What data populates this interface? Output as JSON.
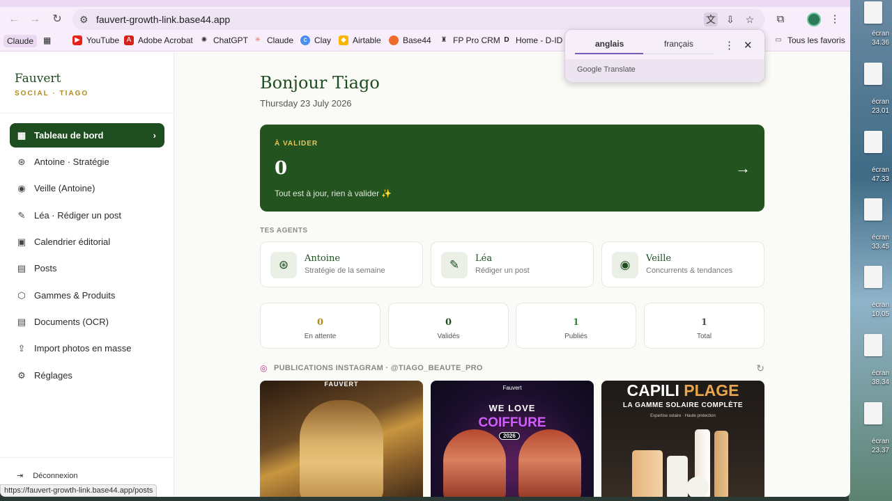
{
  "browser": {
    "url": "fauvert-growth-link.base44.app",
    "bookmarks": [
      "Claude",
      "YouTube",
      "Adobe Acrobat",
      "ChatGPT",
      "Claude",
      "Clay",
      "Airtable",
      "Base44",
      "FP Pro CRM",
      "Home - D-ID"
    ],
    "all_bookmarks": "Tous les favoris",
    "status_url": "https://fauvert-growth-link.base44.app/posts"
  },
  "translate_popup": {
    "lang_from": "anglais",
    "lang_to": "français",
    "brand": "Google Translate"
  },
  "sidebar": {
    "brand": "Fauvert",
    "subtitle": "SOCIAL · TIAGO",
    "items": [
      {
        "label": "Tableau de bord",
        "icon": "grid-icon"
      },
      {
        "label": "Antoine · Stratégie",
        "icon": "brain-icon"
      },
      {
        "label": "Veille (Antoine)",
        "icon": "eye-icon"
      },
      {
        "label": "Léa · Rédiger un post",
        "icon": "pen-icon"
      },
      {
        "label": "Calendrier éditorial",
        "icon": "calendar-icon"
      },
      {
        "label": "Posts",
        "icon": "document-icon"
      },
      {
        "label": "Gammes & Produits",
        "icon": "box-icon"
      },
      {
        "label": "Documents (OCR)",
        "icon": "file-icon"
      },
      {
        "label": "Import photos en masse",
        "icon": "upload-icon"
      },
      {
        "label": "Réglages",
        "icon": "gear-icon"
      }
    ],
    "logout": "Déconnexion"
  },
  "main": {
    "greeting": "Bonjour Tiago",
    "date": "Thursday 23 July 2026",
    "hero": {
      "label": "À VALIDER",
      "count": "0",
      "message": "Tout est à jour, rien à valider ✨"
    },
    "agents_title": "TES AGENTS",
    "agents": [
      {
        "name": "Antoine",
        "desc": "Stratégie de la semaine"
      },
      {
        "name": "Léa",
        "desc": "Rédiger un post"
      },
      {
        "name": "Veille",
        "desc": "Concurrents & tendances"
      }
    ],
    "stats": [
      {
        "value": "0",
        "label": "En attente",
        "color": "#b08a1a"
      },
      {
        "value": "0",
        "label": "Validés",
        "color": "#1e4d20"
      },
      {
        "value": "1",
        "label": "Publiés",
        "color": "#2e8b3a"
      },
      {
        "value": "1",
        "label": "Total",
        "color": "#555555"
      }
    ],
    "instagram_title": "PUBLICATIONS INSTAGRAM · @TIAGO_BEAUTE_PRO",
    "posts": {
      "p1_logo": "FAUVERT",
      "p2_logo": "Fauvert",
      "p2_line1": "WE LOVE",
      "p2_line2": "COIFFURE",
      "p2_year": "2026",
      "p3_title_a": "CAPILI",
      "p3_title_b": "PLAGE",
      "p3_sub": "LA GAMME SOLAIRE COMPLÈTE",
      "p3_tag": "Expertise solaire · Haute protection"
    }
  },
  "desktop": {
    "labels": [
      "écran\n34.36",
      "écran\n23.01",
      "écran\n47.33",
      "écran\n33.45",
      "écran\n10.05",
      "écran\n38.34",
      "écran\n23.37"
    ]
  }
}
